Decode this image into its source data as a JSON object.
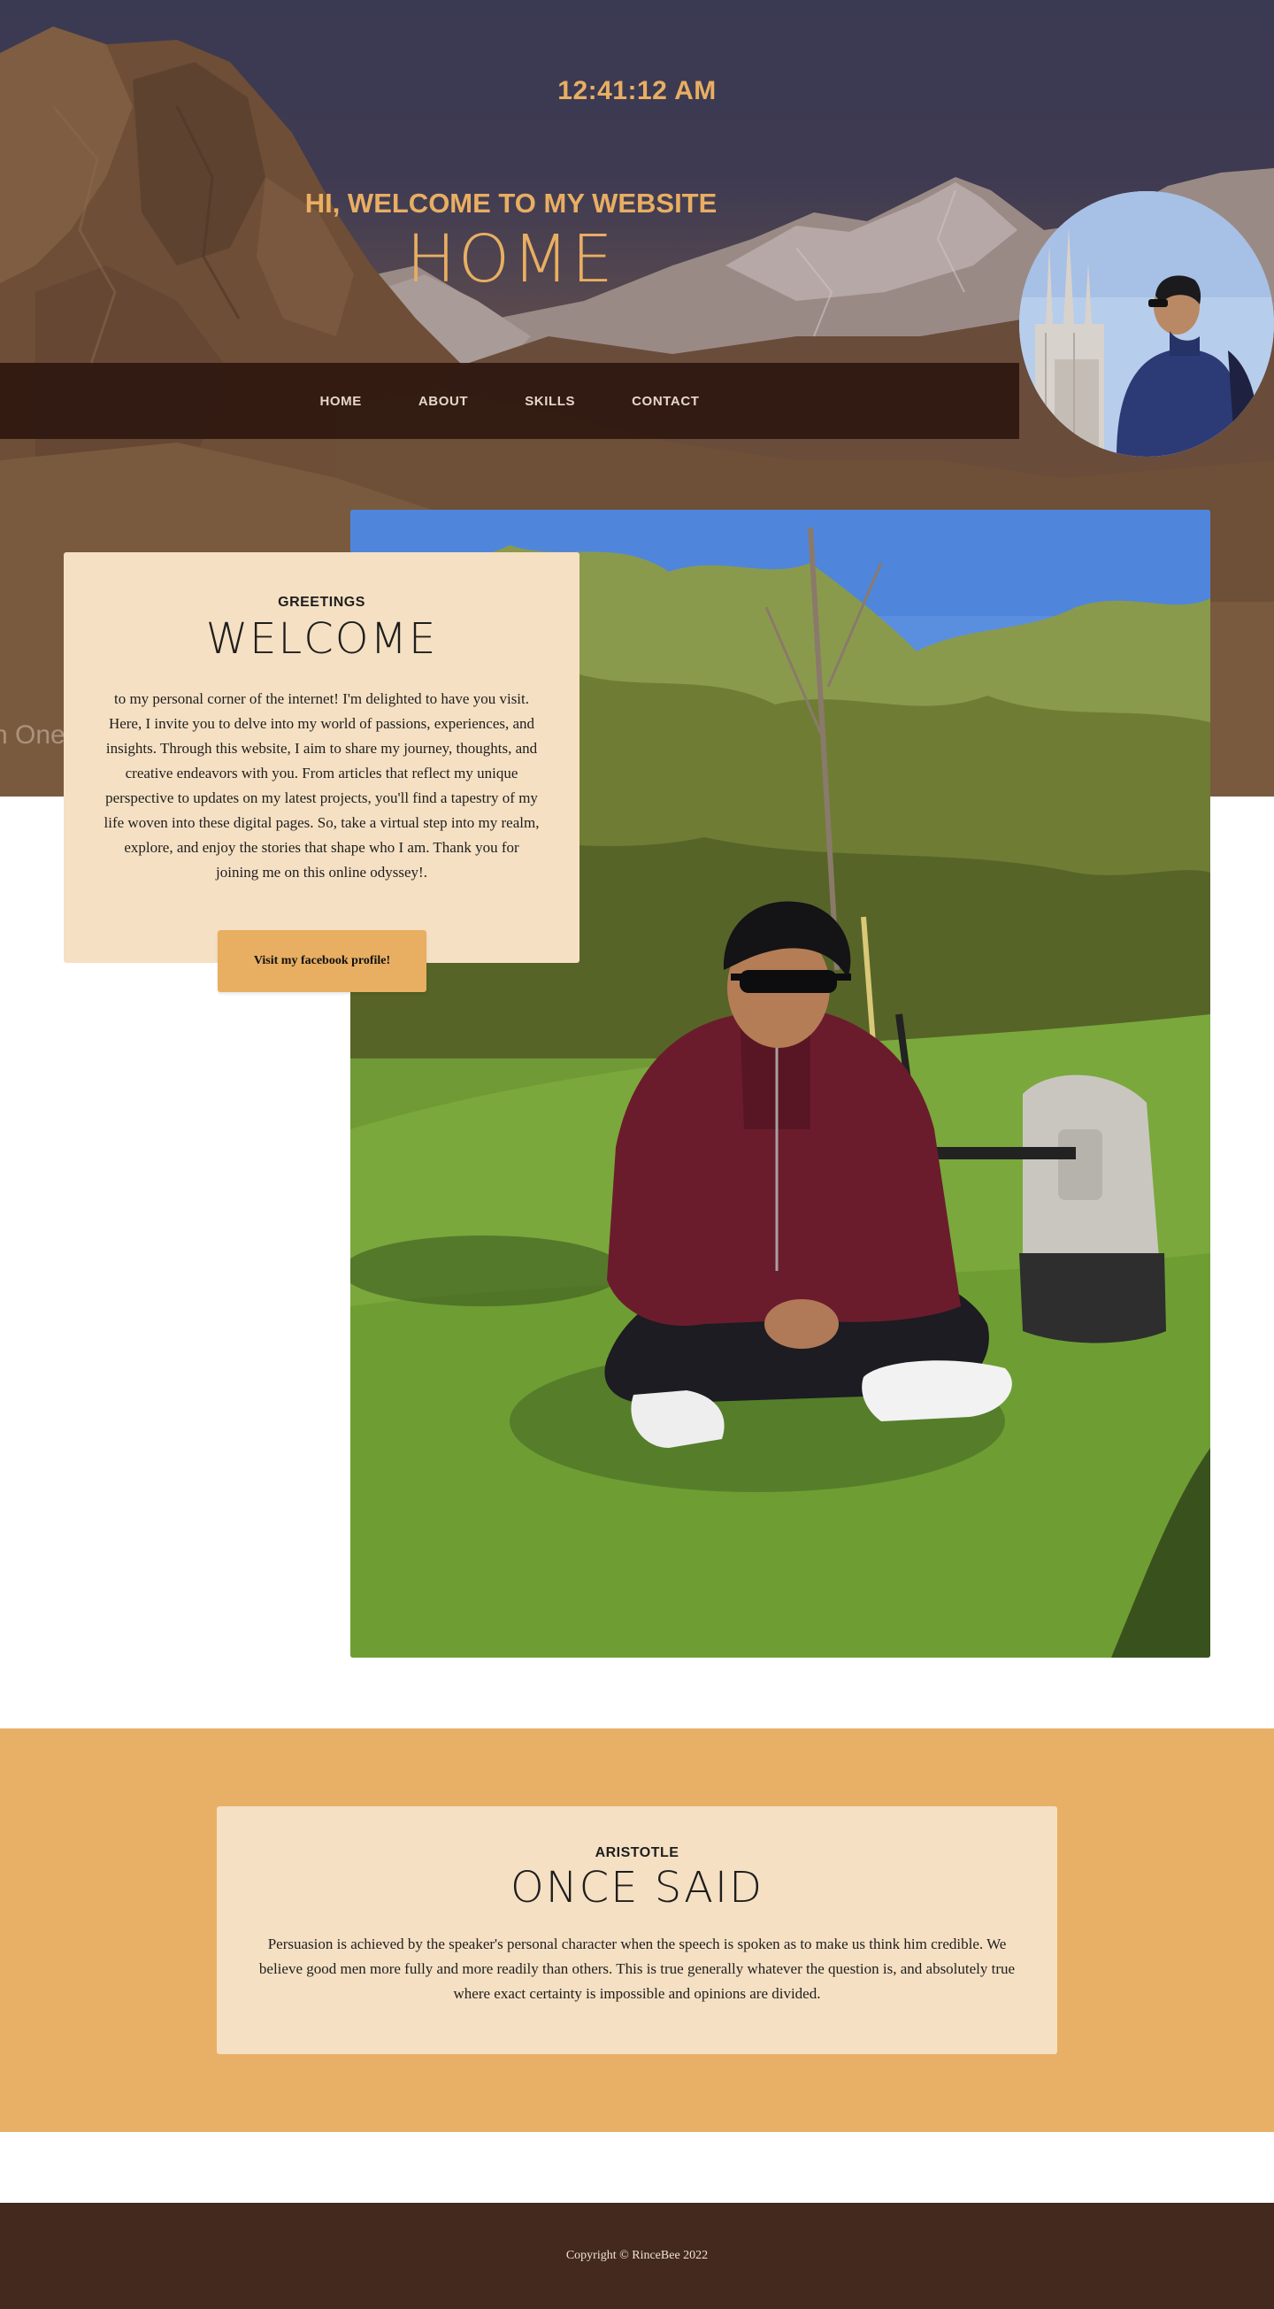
{
  "hero": {
    "clock": "12:41:12 AM",
    "welcome": "HI, WELCOME TO MY WEBSITE",
    "title": "HOME",
    "faded_text": "n One"
  },
  "nav": {
    "items": [
      {
        "label": "HOME"
      },
      {
        "label": "ABOUT"
      },
      {
        "label": "SKILLS"
      },
      {
        "label": "CONTACT"
      }
    ]
  },
  "greeting": {
    "kicker": "GREETINGS",
    "title": "WELCOME",
    "body": "to my personal corner of the internet! I'm delighted to have you visit. Here, I invite you to delve into my world of passions, experiences, and insights. Through this website, I aim to share my journey, thoughts, and creative endeavors with you. From articles that reflect my unique perspective to updates on my latest projects, you'll find a tapestry of my life woven into these digital pages. So, take a virtual step into my realm, explore, and enjoy the stories that shape who I am. Thank you for joining me on this online odyssey!.",
    "button_label": "Visit my facebook profile!"
  },
  "quote": {
    "kicker": "ARISTOTLE",
    "title": "ONCE SAID",
    "body": "Persuasion is achieved by the speaker's personal character when the speech is spoken as to make us think him credible. We believe good men more fully and more readily than others. This is true generally whatever the question is, and absolutely true where exact certainty is impossible and opinions are divided."
  },
  "footer": {
    "copyright": "Copyright © RinceBee 2022"
  },
  "colors": {
    "accent": "#e8ae62",
    "card": "#f5e0c3",
    "navbar": "#2c160e",
    "footer": "#44291f"
  }
}
